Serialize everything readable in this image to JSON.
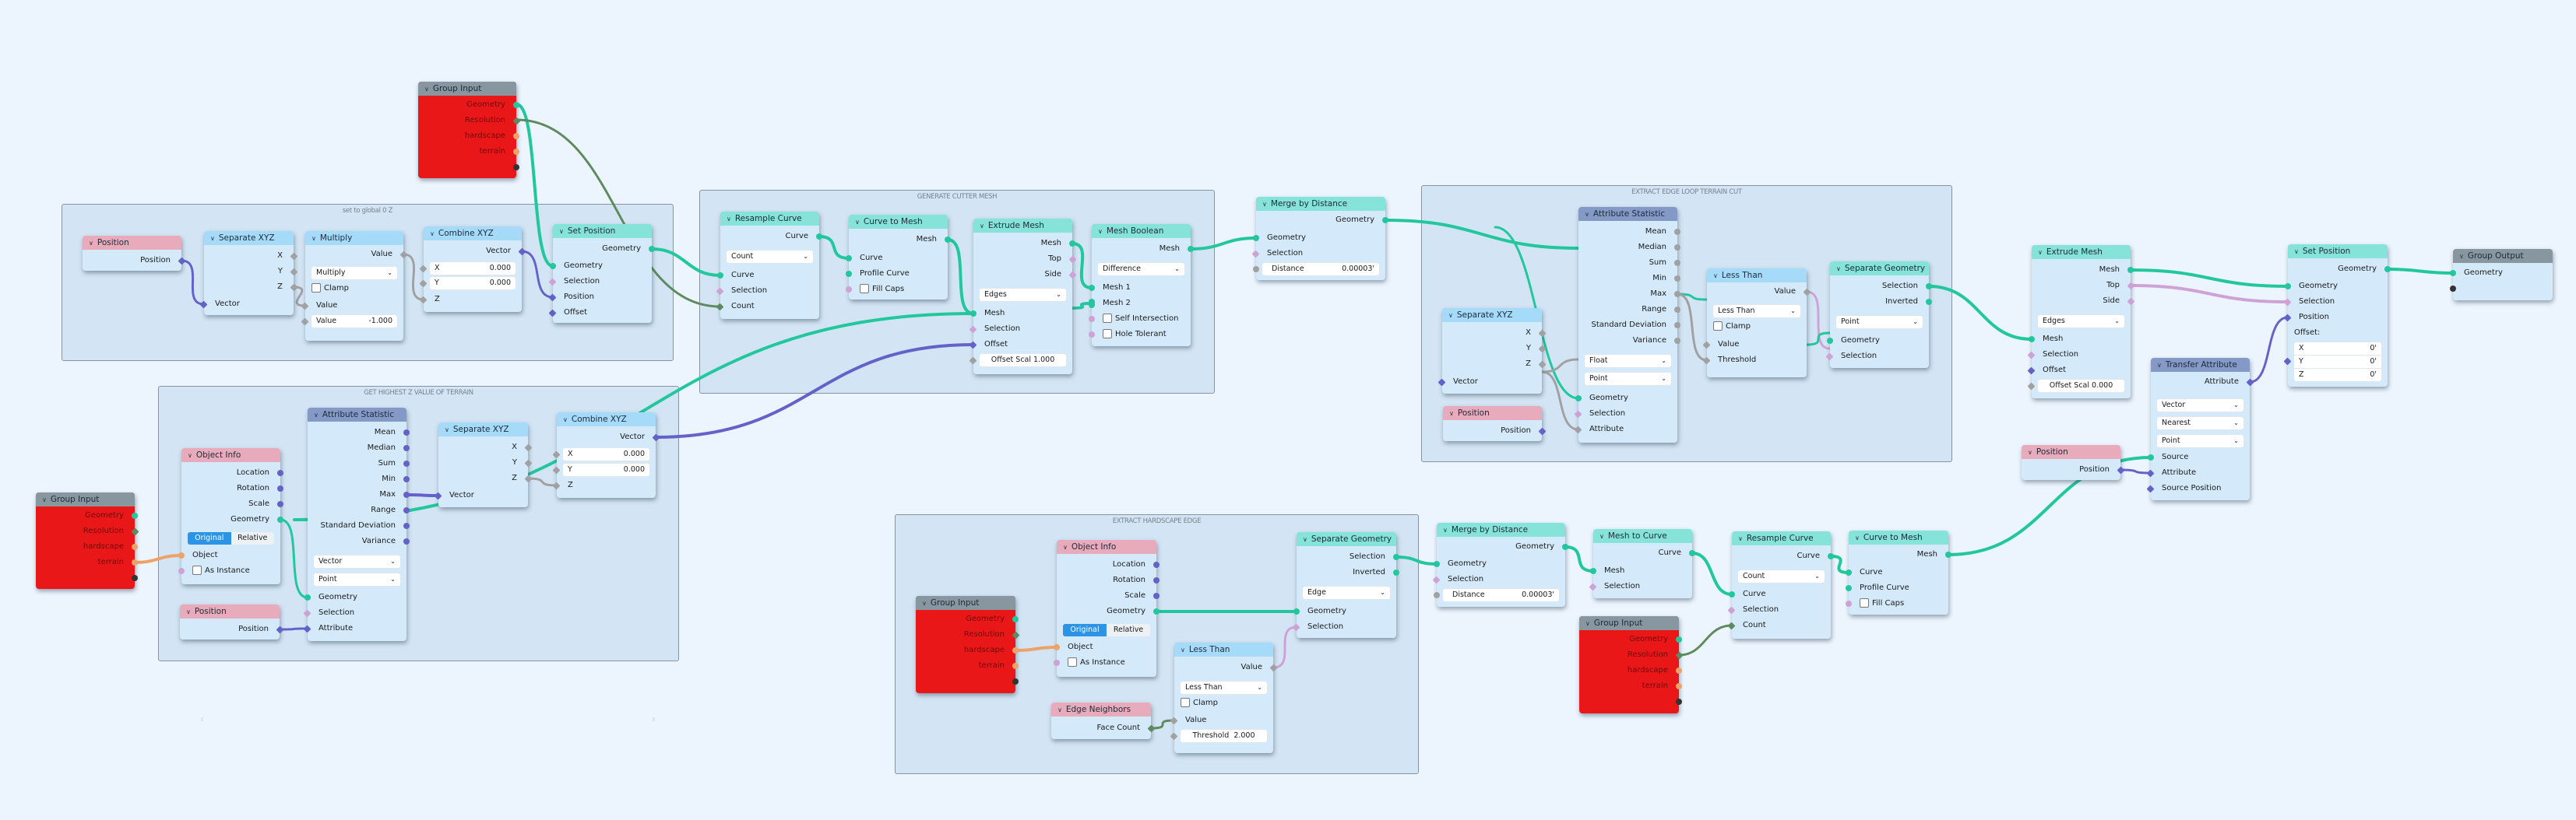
{
  "frames": {
    "set_global": "set to global 0 Z",
    "highest_z": "GET HIGHEST Z VALUE OF TERRAIN",
    "cutter": "GENERATE CUTTER MESH",
    "edge_loop": "EXTRACT EDGE LOOP TERRAIN CUT",
    "hardscape": "EXTRACT HARDSCAPE EDGE"
  },
  "colors": {
    "background": "#ecf5fe",
    "frame": "#d3e5f4",
    "node_body": "#d4eafb",
    "group_input_body": "#ea1719",
    "geometry_socket": "#23c79e",
    "vector_socket": "#6462c8",
    "float_socket": "#a1a1a1",
    "bool_socket": "#cfa2d6",
    "int_socket": "#5d8b5f",
    "object_socket": "#eda267"
  },
  "group_input": {
    "title": "Group Input",
    "outputs": [
      "Geometry",
      "Resolution",
      "hardscape",
      "terrain"
    ]
  },
  "group_output": {
    "title": "Group Output",
    "inputs": [
      "Geometry"
    ]
  },
  "position": {
    "title": "Position",
    "output": "Position"
  },
  "separate_xyz": {
    "title": "Separate XYZ",
    "outputs": [
      "X",
      "Y",
      "Z"
    ],
    "input": "Vector"
  },
  "combine_xyz": {
    "title": "Combine XYZ",
    "output": "Vector",
    "x_label": "X",
    "x_value": "0.000",
    "y_label": "Y",
    "y_value": "0.000",
    "z_label": "Z"
  },
  "multiply": {
    "title": "Multiply",
    "output": "Value",
    "operation": "Multiply",
    "clamp": "Clamp",
    "input": "Value",
    "value_label": "Value",
    "value": "-1.000"
  },
  "set_position": {
    "title": "Set Position",
    "output": "Geometry",
    "inputs": [
      "Geometry",
      "Selection",
      "Position",
      "Offset"
    ],
    "offset_label": "Offset:",
    "offset_x": "0'",
    "offset_y": "0'",
    "offset_z": "0'"
  },
  "object_info": {
    "title": "Object Info",
    "outputs": [
      "Location",
      "Rotation",
      "Scale",
      "Geometry"
    ],
    "mode_original": "Original",
    "mode_relative": "Relative",
    "input_object": "Object",
    "as_instance": "As Instance"
  },
  "attribute_statistic": {
    "title": "Attribute Statistic",
    "outputs": [
      "Mean",
      "Median",
      "Sum",
      "Min",
      "Max",
      "Range",
      "Standard Deviation",
      "Variance"
    ],
    "inputs": [
      "Geometry",
      "Selection",
      "Attribute"
    ],
    "type_vector": "Vector",
    "type_float": "Float",
    "domain": "Point"
  },
  "resample_curve": {
    "title": "Resample Curve",
    "output": "Curve",
    "mode": "Count",
    "inputs": [
      "Curve",
      "Selection",
      "Count"
    ]
  },
  "curve_to_mesh": {
    "title": "Curve to Mesh",
    "output": "Mesh",
    "inputs": [
      "Curve",
      "Profile Curve"
    ],
    "fill_caps": "Fill Caps"
  },
  "extrude_mesh": {
    "title": "Extrude Mesh",
    "outputs": [
      "Mesh",
      "Top",
      "Side"
    ],
    "mode": "Edges",
    "inputs": [
      "Mesh",
      "Selection",
      "Offset"
    ],
    "offset_scale_label": "Offset Scal",
    "offset_scale_cutter": "1.000",
    "offset_scale_final": "0.000"
  },
  "mesh_boolean": {
    "title": "Mesh Boolean",
    "output": "Mesh",
    "operation": "Difference",
    "inputs": [
      "Mesh 1",
      "Mesh 2"
    ],
    "self_intersection": "Self Intersection",
    "hole_tolerant": "Hole Tolerant"
  },
  "merge_by_distance": {
    "title": "Merge by Distance",
    "output": "Geometry",
    "inputs": [
      "Geometry",
      "Selection"
    ],
    "distance_label": "Distance",
    "distance_value": "0.00003'"
  },
  "less_than": {
    "title": "Less Than",
    "output": "Value",
    "operation": "Less Than",
    "clamp": "Clamp",
    "inputs": [
      "Value",
      "Threshold"
    ],
    "threshold_label": "Threshold",
    "threshold_value": "2.000"
  },
  "separate_geometry": {
    "title": "Separate Geometry",
    "outputs": [
      "Selection",
      "Inverted"
    ],
    "domain_point": "Point",
    "domain_edge": "Edge",
    "inputs": [
      "Geometry",
      "Selection"
    ]
  },
  "mesh_to_curve": {
    "title": "Mesh to Curve",
    "output": "Curve",
    "inputs": [
      "Mesh",
      "Selection"
    ]
  },
  "edge_neighbors": {
    "title": "Edge Neighbors",
    "output": "Face Count"
  },
  "transfer_attribute": {
    "title": "Transfer Attribute",
    "output": "Attribute",
    "data_type": "Vector",
    "mapping": "Nearest",
    "domain": "Point",
    "inputs": [
      "Source",
      "Attribute",
      "Source Position"
    ]
  }
}
